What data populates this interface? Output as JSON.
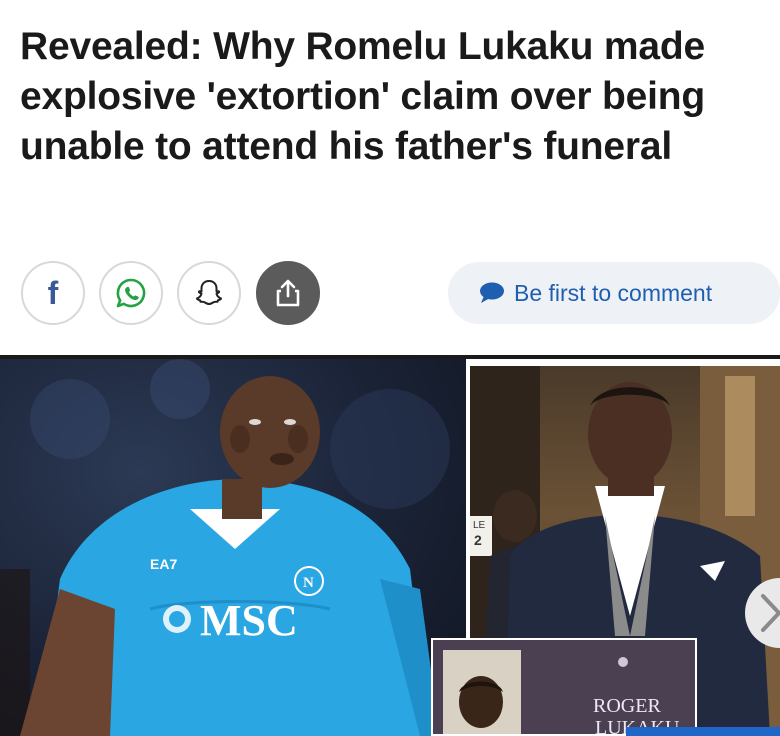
{
  "article": {
    "headline": "Revealed: Why Romelu Lukaku made explosive 'extortion' claim over being unable to attend his father's funeral"
  },
  "share": {
    "facebook_icon": "facebook-icon",
    "whatsapp_icon": "whatsapp-icon",
    "snapchat_icon": "snapchat-icon",
    "share_icon": "share-icon",
    "facebook_letter": "f"
  },
  "comments": {
    "label": "Be first to comment",
    "icon": "speech-bubble-icon"
  },
  "photos": {
    "main_jersey_brand": "EA7",
    "main_sponsor": "MSC",
    "main_crest_letter": "N",
    "right_sign_text": "LE",
    "right_sign_number": "2",
    "inset_text_line1": "ROGER",
    "inset_text_line2": "LUKAKU",
    "next_icon": "chevron-right-icon"
  },
  "colors": {
    "brand_blue": "#1f5fb0",
    "facebook_blue": "#3b5998",
    "whatsapp_green": "#25a244",
    "jersey_blue": "#2aa6e3"
  }
}
